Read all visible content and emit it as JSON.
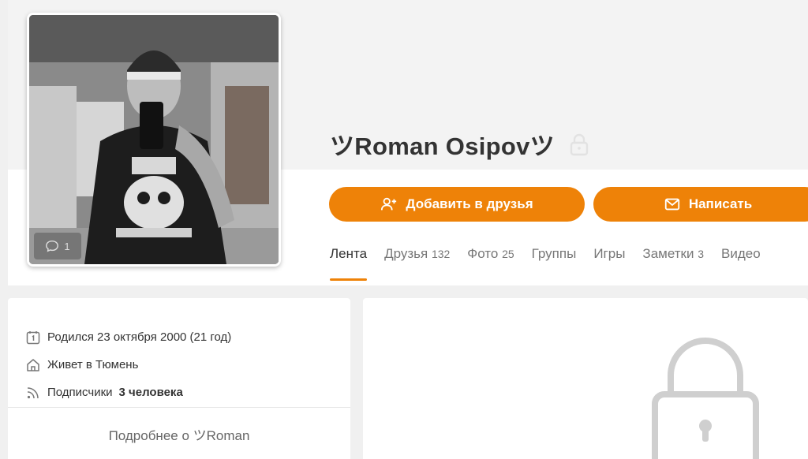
{
  "profile": {
    "name": "ツRoman Osipovツ",
    "avatar_comments": "1"
  },
  "actions": {
    "add_friend": "Добавить в друзья",
    "write": "Написать"
  },
  "tabs": [
    {
      "label": "Лента",
      "count": ""
    },
    {
      "label": "Друзья",
      "count": "132"
    },
    {
      "label": "Фото",
      "count": "25"
    },
    {
      "label": "Группы",
      "count": ""
    },
    {
      "label": "Игры",
      "count": ""
    },
    {
      "label": "Заметки",
      "count": "3"
    },
    {
      "label": "Видео",
      "count": ""
    }
  ],
  "info": {
    "born": "Родился 23 октября 2000 (21 год)",
    "lives": "Живет в Тюмень",
    "subscribers_label": "Подписчики",
    "subscribers_value": "3 человека",
    "more": "Подробнее о ツRoman"
  },
  "colors": {
    "accent": "#ee8208",
    "page_bg": "#f0f0f0"
  },
  "icons": {
    "add_friend": "user-plus-icon",
    "write": "envelope-icon",
    "born": "calendar-icon",
    "lives": "home-icon",
    "subscribers": "rss-icon",
    "profile_lock": "lock-icon",
    "comments": "comment-icon"
  }
}
